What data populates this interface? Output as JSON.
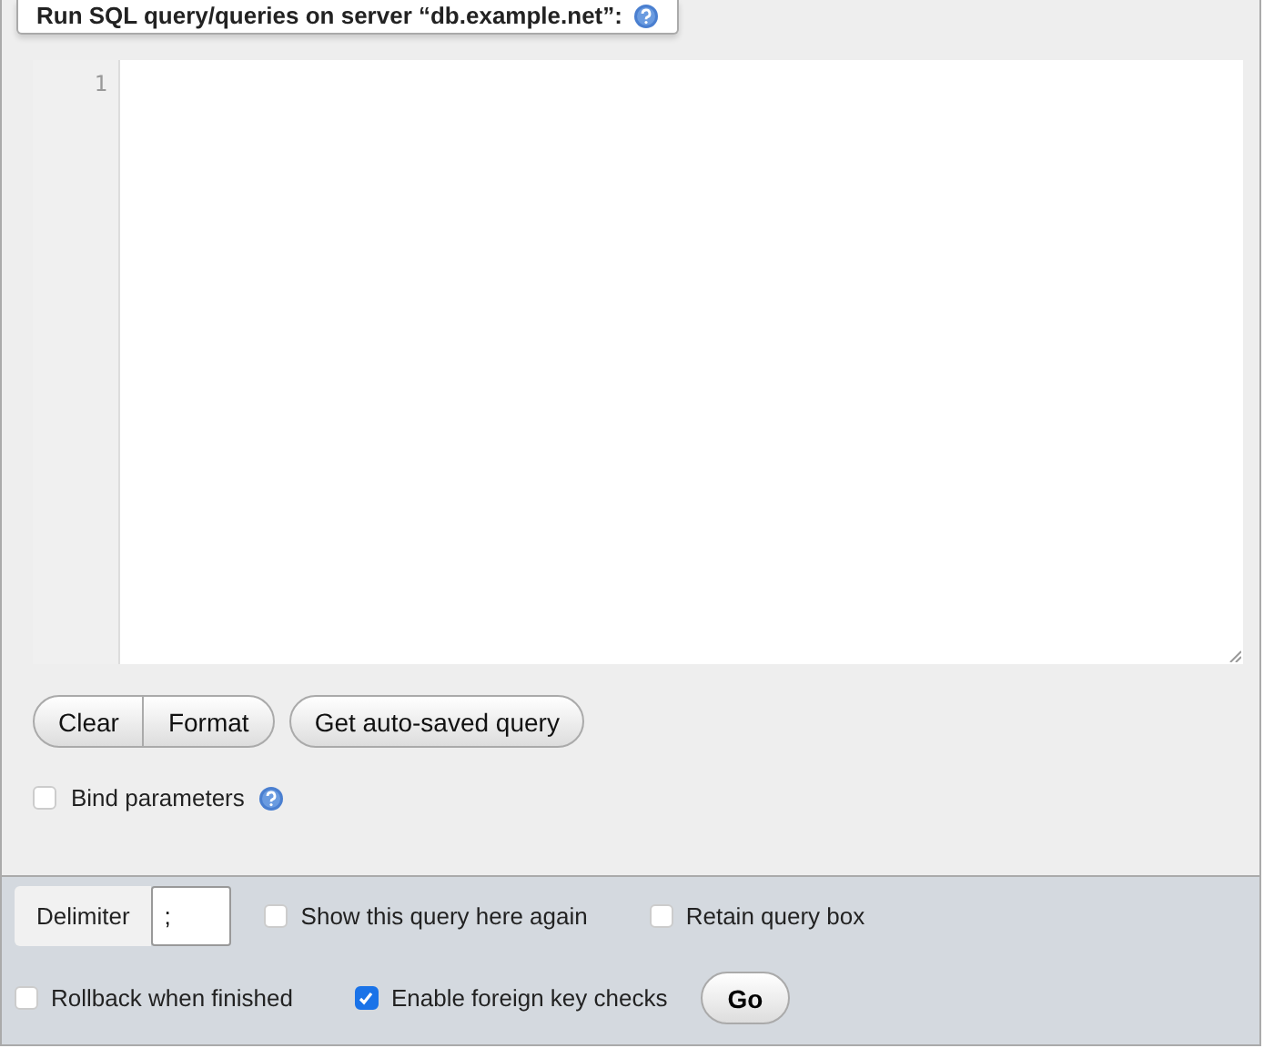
{
  "legend": {
    "title": "Run SQL query/queries on server “db.example.net”:"
  },
  "editor": {
    "line_numbers": [
      "1"
    ]
  },
  "button_groups": [
    [
      "Clear",
      "Format"
    ],
    [
      "Get auto-saved query"
    ]
  ],
  "bind_parameters": {
    "label": "Bind parameters",
    "checked": false
  },
  "footer": {
    "delimiter": {
      "label": "Delimiter",
      "value": ";"
    },
    "options_row_1": [
      {
        "label": "Show this query here again",
        "checked": false
      },
      {
        "label": "Retain query box",
        "checked": false
      }
    ],
    "options_row_2": [
      {
        "label": "Rollback when finished",
        "checked": false
      },
      {
        "label": "Enable foreign key checks",
        "checked": true
      }
    ],
    "go_button": "Go"
  }
}
